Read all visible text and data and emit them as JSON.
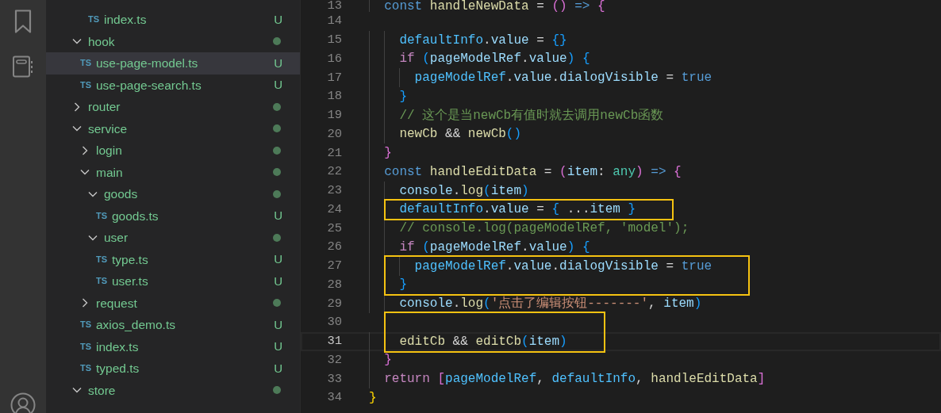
{
  "explorer": {
    "fragment_items": [
      {
        "name": "index.ts",
        "kind": "file",
        "icon": "TS",
        "badge": "U",
        "selected": false
      }
    ],
    "items": [
      {
        "name": "hook",
        "kind": "folder",
        "expanded": true,
        "selected": false,
        "children": [
          {
            "name": "use-page-model.ts",
            "kind": "file",
            "icon": "TS",
            "badge": "U",
            "selected": true
          },
          {
            "name": "use-page-search.ts",
            "kind": "file",
            "icon": "TS",
            "badge": "U",
            "selected": false
          }
        ]
      },
      {
        "name": "router",
        "kind": "folder",
        "expanded": false,
        "selected": false
      },
      {
        "name": "service",
        "kind": "folder",
        "expanded": true,
        "selected": false,
        "children": [
          {
            "name": "login",
            "kind": "folder",
            "expanded": false,
            "selected": false
          },
          {
            "name": "main",
            "kind": "folder",
            "expanded": true,
            "selected": false,
            "children": [
              {
                "name": "goods",
                "kind": "folder",
                "expanded": true,
                "selected": false,
                "children": [
                  {
                    "name": "goods.ts",
                    "kind": "file",
                    "icon": "TS",
                    "badge": "U",
                    "selected": false
                  }
                ]
              },
              {
                "name": "user",
                "kind": "folder",
                "expanded": true,
                "selected": false,
                "children": [
                  {
                    "name": "type.ts",
                    "kind": "file",
                    "icon": "TS",
                    "badge": "U",
                    "selected": false
                  },
                  {
                    "name": "user.ts",
                    "kind": "file",
                    "icon": "TS",
                    "badge": "U",
                    "selected": false
                  }
                ]
              }
            ]
          },
          {
            "name": "request",
            "kind": "folder",
            "expanded": false,
            "selected": false
          },
          {
            "name": "axios_demo.ts",
            "kind": "file",
            "icon": "TS",
            "badge": "U",
            "selected": false
          },
          {
            "name": "index.ts",
            "kind": "file",
            "icon": "TS",
            "badge": "U",
            "selected": false
          },
          {
            "name": "typed.ts",
            "kind": "file",
            "icon": "TS",
            "badge": "U",
            "selected": false
          }
        ]
      },
      {
        "name": "store",
        "kind": "folder",
        "expanded": true,
        "selected": false
      }
    ]
  },
  "editor": {
    "lines": [
      {
        "number": "13",
        "current": false,
        "tokens": [
          {
            "text": "  const ",
            "kind": "kw"
          },
          {
            "text": "handleNewData",
            "kind": "fn"
          },
          {
            "text": " = ",
            "kind": "p"
          },
          {
            "text": "()",
            "kind": "b2"
          },
          {
            "text": " => ",
            "kind": "kw"
          },
          {
            "text": "{",
            "kind": "b2"
          }
        ]
      },
      {
        "number": "14",
        "current": false
      },
      {
        "number": "15",
        "current": false,
        "tokens": [
          {
            "text": "    defaultInfo",
            "kind": "var"
          },
          {
            "text": ".",
            "kind": "p"
          },
          {
            "text": "value",
            "kind": "prop"
          },
          {
            "text": " = ",
            "kind": "p"
          },
          {
            "text": "{}",
            "kind": "b3"
          }
        ]
      },
      {
        "number": "16",
        "current": false,
        "tokens": [
          {
            "text": "    if ",
            "kind": "ctl"
          },
          {
            "text": "(",
            "kind": "b3"
          },
          {
            "text": "pageModelRef",
            "kind": "prop"
          },
          {
            "text": ".",
            "kind": "p"
          },
          {
            "text": "value",
            "kind": "prop"
          },
          {
            "text": ")",
            "kind": "b3"
          },
          {
            "text": " {",
            "kind": "b3"
          }
        ]
      },
      {
        "number": "17",
        "current": false,
        "tokens": [
          {
            "text": "      pageModelRef",
            "kind": "var"
          },
          {
            "text": ".",
            "kind": "p"
          },
          {
            "text": "value",
            "kind": "prop"
          },
          {
            "text": ".",
            "kind": "p"
          },
          {
            "text": "dialogVisible",
            "kind": "prop"
          },
          {
            "text": " = ",
            "kind": "p"
          },
          {
            "text": "true",
            "kind": "kw"
          }
        ]
      },
      {
        "number": "18",
        "current": false,
        "tokens": [
          {
            "text": "    }",
            "kind": "b3"
          }
        ]
      },
      {
        "number": "19",
        "current": false,
        "tokens": [
          {
            "text": "    // 这个是当newCb有值时就去调用newCb函数",
            "kind": "cmt"
          }
        ]
      },
      {
        "number": "20",
        "current": false,
        "tokens": [
          {
            "text": "    newCb",
            "kind": "fn"
          },
          {
            "text": " && ",
            "kind": "p"
          },
          {
            "text": "newCb",
            "kind": "fn"
          },
          {
            "text": "()",
            "kind": "b3"
          }
        ]
      },
      {
        "number": "21",
        "current": false,
        "tokens": [
          {
            "text": "  }",
            "kind": "b2"
          }
        ]
      },
      {
        "number": "22",
        "current": false,
        "tokens": [
          {
            "text": "  const ",
            "kind": "kw"
          },
          {
            "text": "handleEditData",
            "kind": "fn"
          },
          {
            "text": " = ",
            "kind": "p"
          },
          {
            "text": "(",
            "kind": "b2"
          },
          {
            "text": "item",
            "kind": "prop"
          },
          {
            "text": ": ",
            "kind": "p"
          },
          {
            "text": "any",
            "kind": "type"
          },
          {
            "text": ")",
            "kind": "b2"
          },
          {
            "text": " => ",
            "kind": "kw"
          },
          {
            "text": "{",
            "kind": "b2"
          }
        ]
      },
      {
        "number": "23",
        "current": false,
        "tokens": [
          {
            "text": "    console",
            "kind": "prop"
          },
          {
            "text": ".",
            "kind": "p"
          },
          {
            "text": "log",
            "kind": "fn"
          },
          {
            "text": "(",
            "kind": "b3"
          },
          {
            "text": "item",
            "kind": "prop"
          },
          {
            "text": ")",
            "kind": "b3"
          }
        ]
      },
      {
        "number": "24",
        "current": false,
        "boxed": true,
        "tokens": [
          {
            "text": "    defaultInfo",
            "kind": "var"
          },
          {
            "text": ".",
            "kind": "p"
          },
          {
            "text": "value",
            "kind": "prop"
          },
          {
            "text": " = ",
            "kind": "p"
          },
          {
            "text": "{",
            "kind": "b3"
          },
          {
            "text": " ...",
            "kind": "p"
          },
          {
            "text": "item",
            "kind": "prop"
          },
          {
            "text": " }",
            "kind": "b3"
          }
        ]
      },
      {
        "number": "25",
        "current": false,
        "tokens": [
          {
            "text": "    // console.log(pageModelRef, 'model');",
            "kind": "cmt"
          }
        ]
      },
      {
        "number": "26",
        "current": false,
        "tokens": [
          {
            "text": "    if ",
            "kind": "ctl"
          },
          {
            "text": "(",
            "kind": "b3"
          },
          {
            "text": "pageModelRef",
            "kind": "prop"
          },
          {
            "text": ".",
            "kind": "p"
          },
          {
            "text": "value",
            "kind": "prop"
          },
          {
            "text": ")",
            "kind": "b3"
          },
          {
            "text": " {",
            "kind": "b3"
          }
        ]
      },
      {
        "number": "27",
        "current": false,
        "boxed": true,
        "tokens": [
          {
            "text": "      pageModelRef",
            "kind": "var"
          },
          {
            "text": ".",
            "kind": "p"
          },
          {
            "text": "value",
            "kind": "prop"
          },
          {
            "text": ".",
            "kind": "p"
          },
          {
            "text": "dialogVisible",
            "kind": "prop"
          },
          {
            "text": " = ",
            "kind": "p"
          },
          {
            "text": "true",
            "kind": "kw"
          }
        ]
      },
      {
        "number": "28",
        "current": false,
        "boxed": true,
        "tokens": [
          {
            "text": "    }",
            "kind": "b3"
          }
        ]
      },
      {
        "number": "29",
        "current": false,
        "tokens": [
          {
            "text": "    console",
            "kind": "prop"
          },
          {
            "text": ".",
            "kind": "p"
          },
          {
            "text": "log",
            "kind": "fn"
          },
          {
            "text": "(",
            "kind": "b3"
          },
          {
            "text": "'点击了编辑按钮-------'",
            "kind": "str"
          },
          {
            "text": ", ",
            "kind": "p"
          },
          {
            "text": "item",
            "kind": "prop"
          },
          {
            "text": ")",
            "kind": "b3"
          }
        ]
      },
      {
        "number": "30",
        "current": false,
        "boxed": true
      },
      {
        "number": "31",
        "current": true,
        "boxed": true,
        "tokens": [
          {
            "text": "    editCb",
            "kind": "fn"
          },
          {
            "text": " && ",
            "kind": "p"
          },
          {
            "text": "editCb",
            "kind": "fn"
          },
          {
            "text": "(",
            "kind": "b3"
          },
          {
            "text": "item",
            "kind": "prop"
          },
          {
            "text": ")",
            "kind": "b3"
          }
        ]
      },
      {
        "number": "32",
        "current": false,
        "tokens": [
          {
            "text": "  }",
            "kind": "b2"
          }
        ]
      },
      {
        "number": "33",
        "current": false,
        "tokens": [
          {
            "text": "  return ",
            "kind": "ctl"
          },
          {
            "text": "[",
            "kind": "b2"
          },
          {
            "text": "pageModelRef",
            "kind": "var"
          },
          {
            "text": ", ",
            "kind": "p"
          },
          {
            "text": "defaultInfo",
            "kind": "var"
          },
          {
            "text": ", ",
            "kind": "p"
          },
          {
            "text": "handleEditData",
            "kind": "fn"
          },
          {
            "text": "]",
            "kind": "b2"
          }
        ]
      },
      {
        "number": "34",
        "current": false,
        "tokens": [
          {
            "text": "}",
            "kind": "b1"
          }
        ]
      }
    ]
  }
}
